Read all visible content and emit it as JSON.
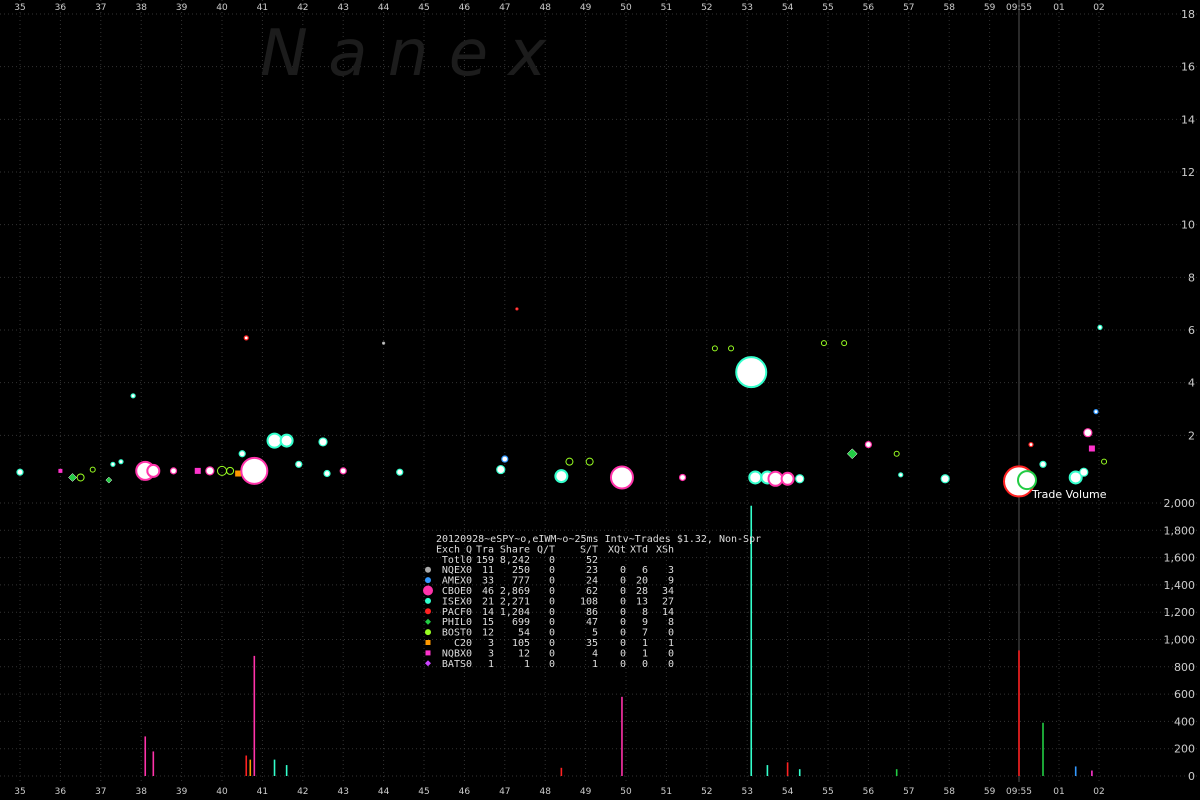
{
  "watermark": "N a n e x",
  "time_axis": {
    "labels": [
      "35",
      "36",
      "37",
      "38",
      "39",
      "40",
      "41",
      "42",
      "43",
      "44",
      "45",
      "46",
      "47",
      "48",
      "49",
      "50",
      "51",
      "52",
      "53",
      "54",
      "55",
      "56",
      "57",
      "58",
      "59",
      "09:55",
      "01",
      "02"
    ]
  },
  "chart_data": [
    {
      "type": "scatter",
      "title": "",
      "ylabel": "",
      "y_ticks": [
        2,
        4,
        6,
        8,
        10,
        12,
        14,
        16,
        18
      ],
      "ylim": [
        0,
        18.5
      ],
      "grid": true,
      "bubble_note": "Circle size represents trade size",
      "points": [
        {
          "t": "35",
          "y": 0.6,
          "s": 3,
          "ex": "ISEX"
        },
        {
          "t": "36",
          "y": 0.65,
          "s": 2,
          "ex": "NQBX"
        },
        {
          "t": "36.3",
          "y": 0.4,
          "s": 3,
          "ex": "PHIL"
        },
        {
          "t": "36.5",
          "y": 0.4,
          "s": 3,
          "ex": "BOST"
        },
        {
          "t": "36.8",
          "y": 0.7,
          "s": 2,
          "ex": "BOST"
        },
        {
          "t": "37.2",
          "y": 0.3,
          "s": 2,
          "ex": "PHIL"
        },
        {
          "t": "37.3",
          "y": 0.9,
          "s": 2,
          "ex": "ISEX"
        },
        {
          "t": "37.5",
          "y": 1.0,
          "s": 2,
          "ex": "ISEX"
        },
        {
          "t": "37.8",
          "y": 3.5,
          "s": 2,
          "ex": "ISEX"
        },
        {
          "t": "38.1",
          "y": 0.65,
          "s": 8,
          "ex": "CBOE"
        },
        {
          "t": "38.3",
          "y": 0.65,
          "s": 5,
          "ex": "CBOE"
        },
        {
          "t": "38.8",
          "y": 0.65,
          "s": 3,
          "ex": "CBOE"
        },
        {
          "t": "39.4",
          "y": 0.65,
          "s": 3,
          "ex": "NQBX"
        },
        {
          "t": "39.7",
          "y": 0.65,
          "s": 4,
          "ex": "CBOE"
        },
        {
          "t": "40.0",
          "y": 0.65,
          "s": 4,
          "ex": "BOST"
        },
        {
          "t": "40.2",
          "y": 0.65,
          "s": 3,
          "ex": "BOST"
        },
        {
          "t": "40.4",
          "y": 0.55,
          "s": 3,
          "ex": "C2"
        },
        {
          "t": "40.5",
          "y": 1.3,
          "s": 3,
          "ex": "ISEX"
        },
        {
          "t": "40.6",
          "y": 5.7,
          "s": 2,
          "ex": "PACF"
        },
        {
          "t": "40.8",
          "y": 0.65,
          "s": 12,
          "ex": "CBOE"
        },
        {
          "t": "41.3",
          "y": 1.8,
          "s": 6,
          "ex": "ISEX"
        },
        {
          "t": "41.6",
          "y": 1.8,
          "s": 5,
          "ex": "ISEX"
        },
        {
          "t": "41.9",
          "y": 0.9,
          "s": 3,
          "ex": "ISEX"
        },
        {
          "t": "42.5",
          "y": 1.75,
          "s": 4,
          "ex": "ISEX"
        },
        {
          "t": "42.6",
          "y": 0.55,
          "s": 3,
          "ex": "ISEX"
        },
        {
          "t": "43.0",
          "y": 0.65,
          "s": 3,
          "ex": "CBOE"
        },
        {
          "t": "44.0",
          "y": 5.5,
          "s": 1,
          "ex": "NQEX"
        },
        {
          "t": "44.4",
          "y": 0.6,
          "s": 3,
          "ex": "ISEX"
        },
        {
          "t": "46.9",
          "y": 0.7,
          "s": 4,
          "ex": "ISEX"
        },
        {
          "t": "47.0",
          "y": 1.1,
          "s": 3,
          "ex": "AMEX"
        },
        {
          "t": "47.3",
          "y": 6.8,
          "s": 1,
          "ex": "PACF"
        },
        {
          "t": "48.4",
          "y": 0.45,
          "s": 5,
          "ex": "ISEX"
        },
        {
          "t": "48.6",
          "y": 1.0,
          "s": 3,
          "ex": "BOST"
        },
        {
          "t": "49.1",
          "y": 1.0,
          "s": 3,
          "ex": "BOST"
        },
        {
          "t": "49.9",
          "y": 0.4,
          "s": 10,
          "ex": "CBOE"
        },
        {
          "t": "51.4",
          "y": 0.4,
          "s": 3,
          "ex": "CBOE"
        },
        {
          "t": "52.2",
          "y": 5.3,
          "s": 2,
          "ex": "BOST"
        },
        {
          "t": "52.6",
          "y": 5.3,
          "s": 2,
          "ex": "BOST"
        },
        {
          "t": "53.1",
          "y": 4.4,
          "s": 14,
          "ex": "ISEX"
        },
        {
          "t": "53.2",
          "y": 0.4,
          "s": 5,
          "ex": "ISEX"
        },
        {
          "t": "53.5",
          "y": 0.4,
          "s": 5,
          "ex": "ISEX"
        },
        {
          "t": "53.7",
          "y": 0.35,
          "s": 6,
          "ex": "CBOE"
        },
        {
          "t": "54.0",
          "y": 0.35,
          "s": 5,
          "ex": "CBOE"
        },
        {
          "t": "54.3",
          "y": 0.35,
          "s": 4,
          "ex": "ISEX"
        },
        {
          "t": "54.9",
          "y": 5.5,
          "s": 2,
          "ex": "BOST"
        },
        {
          "t": "55.4",
          "y": 5.5,
          "s": 2,
          "ex": "BOST"
        },
        {
          "t": "55.6",
          "y": 1.3,
          "s": 4,
          "ex": "PHIL"
        },
        {
          "t": "56.0",
          "y": 1.65,
          "s": 3,
          "ex": "CBOE"
        },
        {
          "t": "56.7",
          "y": 1.3,
          "s": 2,
          "ex": "BOST"
        },
        {
          "t": "56.8",
          "y": 0.5,
          "s": 2,
          "ex": "ISEX"
        },
        {
          "t": "57.9",
          "y": 0.35,
          "s": 4,
          "ex": "ISEX"
        },
        {
          "t": "09:55",
          "y": 0.25,
          "s": 14,
          "ex": "PACF"
        },
        {
          "t": "00.2",
          "y": 0.3,
          "s": 8,
          "ex": "PHIL"
        },
        {
          "t": "00.3",
          "y": 1.65,
          "s": 2,
          "ex": "PACF"
        },
        {
          "t": "00.6",
          "y": 0.9,
          "s": 3,
          "ex": "ISEX"
        },
        {
          "t": "01.4",
          "y": 0.4,
          "s": 5,
          "ex": "ISEX"
        },
        {
          "t": "01.6",
          "y": 0.6,
          "s": 4,
          "ex": "ISEX"
        },
        {
          "t": "01.7",
          "y": 2.1,
          "s": 4,
          "ex": "CBOE"
        },
        {
          "t": "01.8",
          "y": 1.5,
          "s": 3,
          "ex": "NQBX"
        },
        {
          "t": "01.9",
          "y": 2.9,
          "s": 2,
          "ex": "AMEX"
        },
        {
          "t": "02.0",
          "y": 6.1,
          "s": 2,
          "ex": "ISEX"
        },
        {
          "t": "02.1",
          "y": 1.0,
          "s": 2,
          "ex": "BOST"
        }
      ]
    },
    {
      "type": "bar",
      "title": "",
      "ylabel": "",
      "y_ticks": [
        0,
        200,
        400,
        600,
        800,
        1000,
        1200,
        1400,
        1600,
        1800,
        2000
      ],
      "ylim": [
        0,
        2000
      ],
      "annotation": "Trade Volume",
      "bars": [
        {
          "t": "38.1",
          "v": 290,
          "ex": "CBOE"
        },
        {
          "t": "38.3",
          "v": 180,
          "ex": "CBOE"
        },
        {
          "t": "40.6",
          "v": 150,
          "ex": "PACF"
        },
        {
          "t": "40.7",
          "v": 120,
          "ex": "C2"
        },
        {
          "t": "40.8",
          "v": 880,
          "ex": "CBOE"
        },
        {
          "t": "41.3",
          "v": 120,
          "ex": "ISEX"
        },
        {
          "t": "41.6",
          "v": 80,
          "ex": "ISEX"
        },
        {
          "t": "48.4",
          "v": 60,
          "ex": "PACF"
        },
        {
          "t": "49.9",
          "v": 580,
          "ex": "CBOE"
        },
        {
          "t": "53.1",
          "v": 1980,
          "ex": "ISEX"
        },
        {
          "t": "53.5",
          "v": 80,
          "ex": "ISEX"
        },
        {
          "t": "54.0",
          "v": 100,
          "ex": "PACF"
        },
        {
          "t": "54.3",
          "v": 50,
          "ex": "ISEX"
        },
        {
          "t": "56.7",
          "v": 50,
          "ex": "PHIL"
        },
        {
          "t": "09:55",
          "v": 920,
          "ex": "PACF"
        },
        {
          "t": "00.6",
          "v": 390,
          "ex": "PHIL"
        },
        {
          "t": "01.4",
          "v": 70,
          "ex": "AMEX"
        },
        {
          "t": "01.8",
          "v": 40,
          "ex": "NQBX"
        }
      ]
    }
  ],
  "stats_table": {
    "title": "20120928~eSPY~o,eIWM~o~25ms Intv~Trades $1.32, Non-Spr",
    "header": [
      "Exch",
      "Q",
      "Tra",
      "Share",
      "Q/T",
      "S/T",
      "XQt",
      "XTd",
      "XSh"
    ],
    "rows": [
      {
        "marker": "",
        "color": "#ffffff",
        "cells": [
          "Totl",
          "0",
          "159",
          "8,242",
          "0",
          "52",
          "",
          "",
          ""
        ]
      },
      {
        "marker": "circle",
        "color": "#aaaaaa",
        "cells": [
          "NQEX",
          "0",
          "11",
          "250",
          "0",
          "23",
          "0",
          "6",
          "3"
        ]
      },
      {
        "marker": "circle",
        "color": "#3399ff",
        "cells": [
          "AMEX",
          "0",
          "33",
          "777",
          "0",
          "24",
          "0",
          "20",
          "9"
        ]
      },
      {
        "marker": "circle",
        "color": "#ff33aa",
        "cells": [
          "CBOE",
          "0",
          "46",
          "2,869",
          "0",
          "62",
          "0",
          "28",
          "34"
        ]
      },
      {
        "marker": "circle",
        "color": "#33ffcc",
        "cells": [
          "ISEX",
          "0",
          "21",
          "2,271",
          "0",
          "108",
          "0",
          "13",
          "27"
        ]
      },
      {
        "marker": "circle",
        "color": "#ff2222",
        "cells": [
          "PACF",
          "0",
          "14",
          "1,204",
          "0",
          "86",
          "0",
          "8",
          "14"
        ]
      },
      {
        "marker": "diamond",
        "color": "#22cc44",
        "cells": [
          "PHIL",
          "0",
          "15",
          "699",
          "0",
          "47",
          "0",
          "9",
          "8"
        ]
      },
      {
        "marker": "circle",
        "color": "#99ff22",
        "cells": [
          "BOST",
          "0",
          "12",
          "54",
          "0",
          "5",
          "0",
          "7",
          "0"
        ]
      },
      {
        "marker": "square",
        "color": "#ff9900",
        "cells": [
          "C2",
          "0",
          "3",
          "105",
          "0",
          "35",
          "0",
          "1",
          "1"
        ]
      },
      {
        "marker": "square",
        "color": "#ff33cc",
        "cells": [
          "NQBX",
          "0",
          "3",
          "12",
          "0",
          "4",
          "0",
          "1",
          "0"
        ]
      },
      {
        "marker": "diamond",
        "color": "#cc44ff",
        "cells": [
          "BATS",
          "0",
          "1",
          "1",
          "0",
          "1",
          "0",
          "0",
          "0"
        ]
      }
    ]
  },
  "exchange_colors": {
    "NQEX": "#aaaaaa",
    "AMEX": "#3399ff",
    "CBOE": "#ff33aa",
    "ISEX": "#33ffcc",
    "PACF": "#ff2222",
    "PHIL": "#22cc44",
    "BOST": "#99ff22",
    "C2": "#ff9900",
    "NQBX": "#ff33cc",
    "BATS": "#cc44ff"
  }
}
